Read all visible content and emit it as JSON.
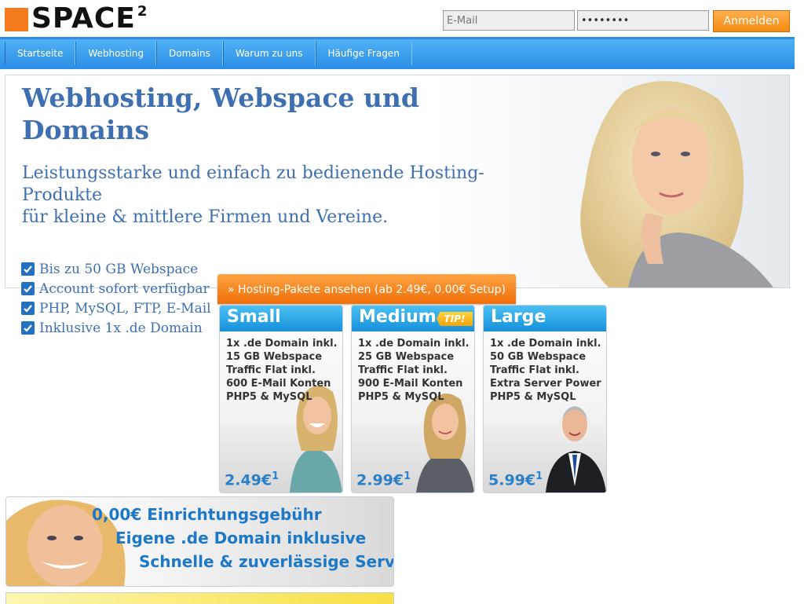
{
  "header": {
    "logo_text": "SPACE",
    "logo_sup": "2",
    "email_placeholder": "E-Mail",
    "password_value": "••••••••",
    "login_label": "Anmelden"
  },
  "nav": [
    "Startseite",
    "Webhosting",
    "Domains",
    "Warum zu uns",
    "Häufige Fragen"
  ],
  "hero": {
    "title": "Webhosting, Webspace und Domains",
    "subtitle_line1": "Leistungsstarke und einfach zu bedienende Hosting-Produkte",
    "subtitle_line2": "für kleine & mittlere Firmen und Vereine."
  },
  "features": [
    "Bis zu 50 GB Webspace",
    "Account sofort verfügbar",
    "PHP, MySQL, FTP, E-Mail",
    "Inklusive 1x .de Domain"
  ],
  "cta_label": "» Hosting-Pakete ansehen (ab 2.49€, 0.00€ Setup)",
  "packages": [
    {
      "name": "Small",
      "features": [
        "1x .de Domain inkl.",
        "15 GB Webspace",
        "Traffic Flat inkl.",
        "600 E-Mail Konten",
        "PHP5 & MySQL"
      ],
      "price": "2.49€",
      "footnote": "1"
    },
    {
      "name": "Medium",
      "badge": "TIP!",
      "features": [
        "1x .de Domain inkl.",
        "25 GB Webspace",
        "Traffic Flat inkl.",
        "900 E-Mail Konten",
        "PHP5 & MySQL"
      ],
      "price": "2.99€",
      "footnote": "1"
    },
    {
      "name": "Large",
      "features": [
        "1x .de Domain inkl.",
        "50 GB Webspace",
        "Traffic Flat inkl.",
        "Extra Server Power",
        "PHP5 & MySQL"
      ],
      "price": "5.99€",
      "footnote": "1"
    }
  ],
  "banner": [
    "0,00€ Einrichtungsgebühr",
    "Eigene .de Domain inklusive",
    "Schnelle & zuverlässige Server"
  ],
  "colors": {
    "brand_orange": "#f47b1e",
    "nav_blue": "#2a8ee6",
    "heading_blue": "#3e6fb1",
    "price_blue": "#2a7fc8"
  }
}
